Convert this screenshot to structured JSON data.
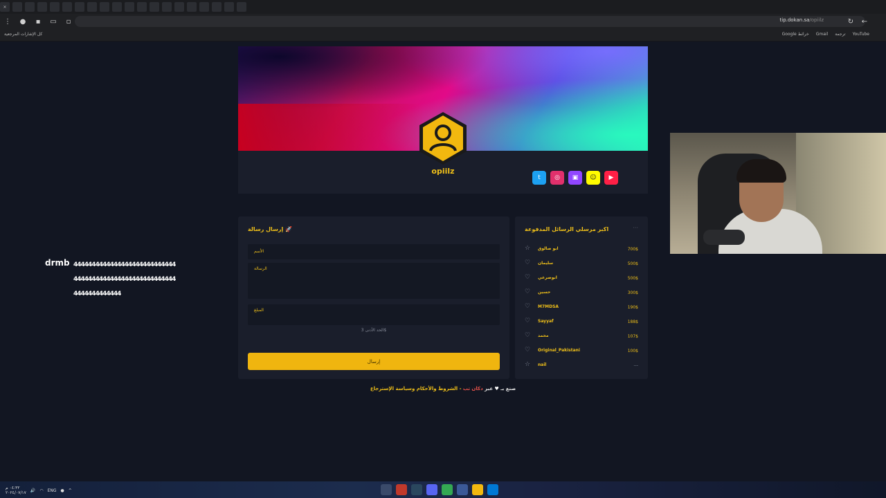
{
  "browser": {
    "url": "tip.dokan.sa",
    "url_path": "/opiilz",
    "bookmarks_left": "كل الإشارات المرجعية",
    "bookmarks_right": [
      "Google خرائط",
      "Gmail",
      "ترجمة",
      "YouTube"
    ]
  },
  "profile": {
    "username": "opiilz",
    "socials": [
      {
        "name": "twitter",
        "color": "#1da1f2",
        "glyph": "t"
      },
      {
        "name": "instagram",
        "color": "#e1306c",
        "glyph": "◎"
      },
      {
        "name": "twitch",
        "color": "#9146ff",
        "glyph": "▣"
      },
      {
        "name": "snapchat",
        "color": "#fffc00",
        "glyph": "☺"
      },
      {
        "name": "youtube",
        "color": "#ff2046",
        "glyph": "▶"
      }
    ]
  },
  "form": {
    "title": "إرسال رسالة",
    "name_label": "الأسم",
    "message_label": "الرسالة",
    "amount_label": "المبلغ",
    "hint": "الحد الأدنى 3$",
    "send_label": "إرسال"
  },
  "top_senders": {
    "title": "اكبر مرسلي الرسائل المدفوعة",
    "rows": [
      {
        "name": "ابو صالوق",
        "amount": "700$",
        "icon": "star-icon"
      },
      {
        "name": "سليمان",
        "amount": "500$",
        "icon": "medal-icon"
      },
      {
        "name": "ابوصرعي",
        "amount": "500$",
        "icon": "medal-icon"
      },
      {
        "name": "حسين",
        "amount": "300$",
        "icon": "medal-icon"
      },
      {
        "name": "M7MDSA",
        "amount": "190$",
        "icon": "medal-icon"
      },
      {
        "name": "Sayyaf",
        "amount": "188$",
        "icon": "medal-icon"
      },
      {
        "name": "محمد",
        "amount": "107$",
        "icon": "medal-icon"
      },
      {
        "name": "Original_Pakistani",
        "amount": "100$",
        "icon": "medal-icon"
      },
      {
        "name": "nail",
        "amount": "---",
        "icon": "star-icon"
      }
    ]
  },
  "footer": {
    "made_by": "صنع بـ",
    "via": "عبر",
    "brand": "دكان تب",
    "links": "- الشروط والأحكام وسياسة الإسترجاع"
  },
  "overlay": {
    "sender": "drmb",
    "message": "444444444444444444444444444444444444444444444444444444444444444444444"
  },
  "taskbar": {
    "time": "٠٤:٣٢ م",
    "date": "٢٠٢٤/٠٧/١٧",
    "lang": "ENG"
  }
}
